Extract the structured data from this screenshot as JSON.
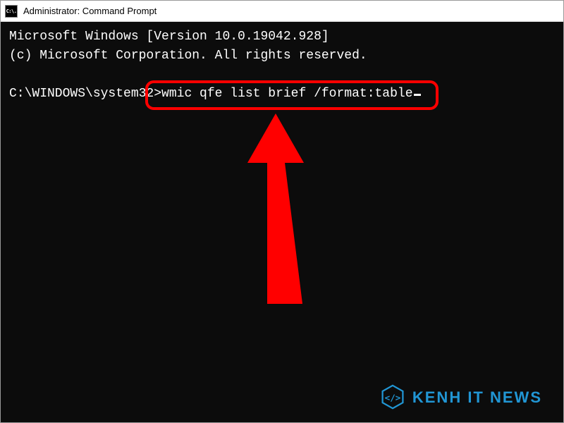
{
  "titlebar": {
    "icon_text": "C:\\.",
    "title": "Administrator: Command Prompt"
  },
  "terminal": {
    "line1": "Microsoft Windows [Version 10.0.19042.928]",
    "line2": "(c) Microsoft Corporation. All rights reserved.",
    "prompt": "C:\\WINDOWS\\system32>",
    "command": "wmic qfe list brief /format:table"
  },
  "annotation": {
    "highlight_color": "#ff0000",
    "arrow_color": "#ff0000"
  },
  "watermark": {
    "text": "KENH IT NEWS",
    "color": "#2196d4"
  }
}
